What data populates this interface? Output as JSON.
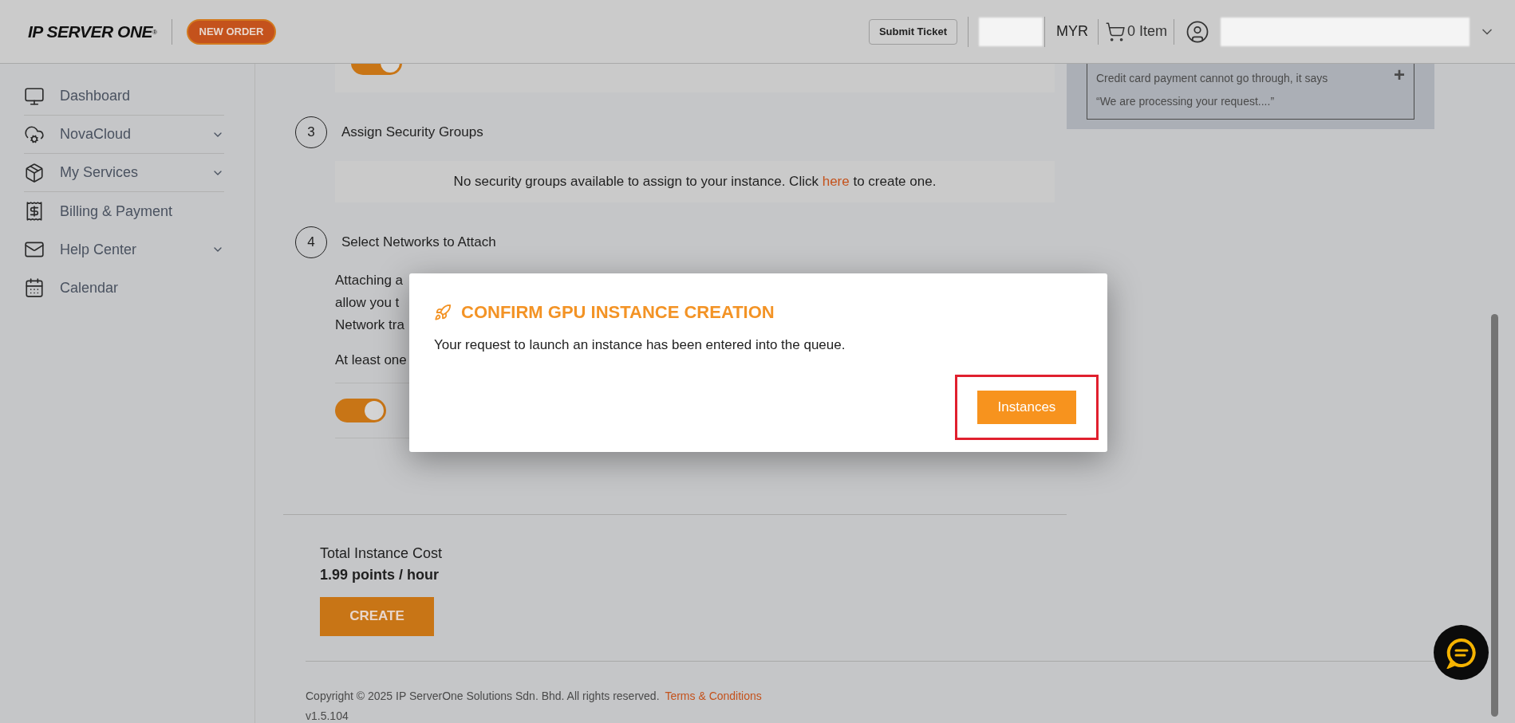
{
  "header": {
    "logo": "IP SERVER ONE",
    "logo_mark": "®",
    "new_order": "NEW ORDER",
    "submit_ticket": "Submit Ticket",
    "currency": "MYR",
    "cart": "0 Item"
  },
  "sidebar": {
    "items": [
      {
        "label": "Dashboard",
        "expandable": false
      },
      {
        "label": "NovaCloud",
        "expandable": true
      },
      {
        "label": "My Services",
        "expandable": true
      },
      {
        "label": "Billing & Payment",
        "expandable": false
      },
      {
        "label": "Help Center",
        "expandable": true
      },
      {
        "label": "Calendar",
        "expandable": false
      }
    ]
  },
  "top_panel": {
    "toggle_on": true
  },
  "help_card": {
    "text": "Credit card payment cannot go through, it says “We are processing your request....”",
    "plus": "+"
  },
  "steps": [
    {
      "number": "3",
      "title": "Assign Security Groups"
    },
    {
      "number": "4",
      "title": "Select Networks to Attach"
    }
  ],
  "security_notice": {
    "before": "No security groups available to assign to your instance. Click ",
    "link": "here",
    "after": " to create one."
  },
  "network": {
    "lines": [
      "Attaching a",
      "allow you t",
      "Network tra"
    ],
    "note": "At least one",
    "toggle_on": true
  },
  "cost": {
    "label": "Total Instance Cost",
    "value": "1.99 points / hour",
    "button": "CREATE"
  },
  "footer": {
    "copyright": "Copyright © 2025 IP ServerOne Solutions Sdn. Bhd. All rights reserved.",
    "terms": "Terms & Conditions",
    "version": "v1.5.104"
  },
  "modal": {
    "title": "CONFIRM GPU INSTANCE CREATION",
    "message": "Your request to launch an instance has been entered into the queue.",
    "button": "Instances",
    "highlighted": true
  }
}
